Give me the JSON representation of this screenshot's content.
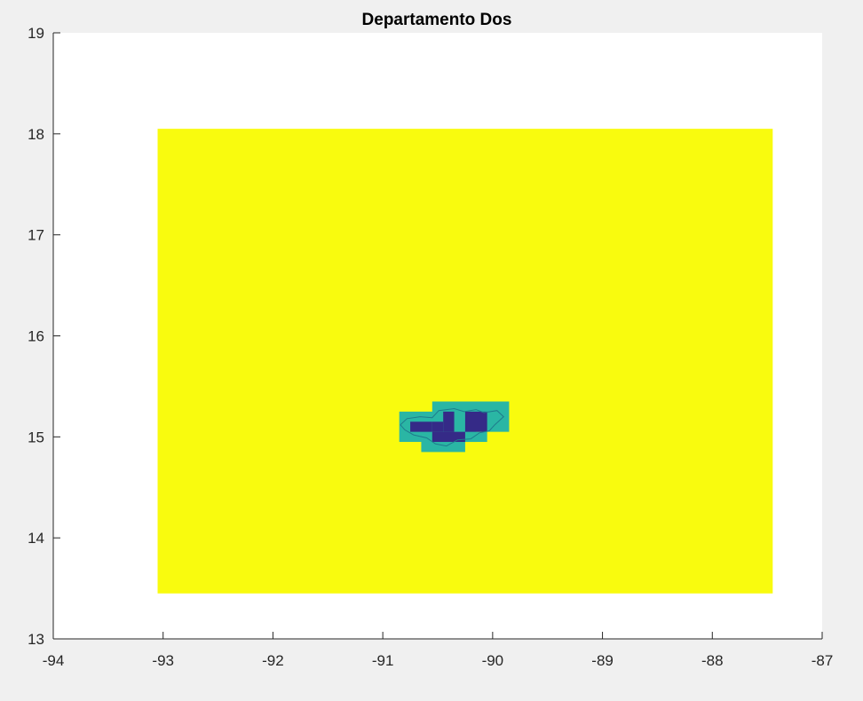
{
  "chart_data": {
    "type": "heatmap",
    "title": "Departamento Dos",
    "xlabel": "",
    "ylabel": "",
    "xlim": [
      -94,
      -87
    ],
    "ylim": [
      13,
      19
    ],
    "xticks": [
      -94,
      -93,
      -92,
      -91,
      -90,
      -89,
      -88,
      -87
    ],
    "yticks": [
      13,
      14,
      15,
      16,
      17,
      18,
      19
    ],
    "xtick_labels": [
      "-94",
      "-93",
      "-92",
      "-91",
      "-90",
      "-89",
      "-88",
      "-87"
    ],
    "ytick_labels": [
      "13",
      "14",
      "15",
      "16",
      "17",
      "18",
      "19"
    ],
    "grid": false,
    "colormap": [
      "#352a87",
      "#2ab6a4",
      "#f9fb0e"
    ],
    "cell_width": 0.1,
    "cell_height": 0.1,
    "cells": [
      {
        "xmin": -93.05,
        "xmax": -87.45,
        "ymin": 13.45,
        "ymax": 18.05,
        "level": 2
      },
      {
        "xmin": -90.85,
        "xmax": -90.15,
        "ymin": 14.95,
        "ymax": 15.25,
        "level": 1
      },
      {
        "xmin": -90.55,
        "xmax": -89.85,
        "ymin": 15.05,
        "ymax": 15.35,
        "level": 1
      },
      {
        "xmin": -90.65,
        "xmax": -90.25,
        "ymin": 14.85,
        "ymax": 15.05,
        "level": 1
      },
      {
        "xmin": -90.25,
        "xmax": -90.05,
        "ymin": 14.95,
        "ymax": 15.05,
        "level": 1
      },
      {
        "xmin": -90.75,
        "xmax": -90.55,
        "ymin": 15.05,
        "ymax": 15.15,
        "level": 0
      },
      {
        "xmin": -90.55,
        "xmax": -90.45,
        "ymin": 15.05,
        "ymax": 15.15,
        "level": 0
      },
      {
        "xmin": -90.45,
        "xmax": -90.35,
        "ymin": 15.05,
        "ymax": 15.25,
        "level": 0
      },
      {
        "xmin": -90.55,
        "xmax": -90.25,
        "ymin": 14.95,
        "ymax": 15.05,
        "level": 0
      },
      {
        "xmin": -90.25,
        "xmax": -90.05,
        "ymin": 15.05,
        "ymax": 15.25,
        "level": 0
      }
    ],
    "boundary": [
      [
        -90.84,
        15.12
      ],
      [
        -90.78,
        15.18
      ],
      [
        -90.66,
        15.2
      ],
      [
        -90.55,
        15.19
      ],
      [
        -90.49,
        15.26
      ],
      [
        -90.35,
        15.28
      ],
      [
        -90.26,
        15.25
      ],
      [
        -90.15,
        15.27
      ],
      [
        -90.08,
        15.24
      ],
      [
        -89.96,
        15.26
      ],
      [
        -89.9,
        15.2
      ],
      [
        -89.98,
        15.12
      ],
      [
        -90.03,
        15.06
      ],
      [
        -90.12,
        15.04
      ],
      [
        -90.2,
        14.98
      ],
      [
        -90.32,
        14.97
      ],
      [
        -90.42,
        14.91
      ],
      [
        -90.52,
        14.93
      ],
      [
        -90.6,
        14.99
      ],
      [
        -90.72,
        15.02
      ],
      [
        -90.8,
        15.07
      ],
      [
        -90.84,
        15.12
      ]
    ],
    "boundary_color": "#1f7a8c"
  }
}
